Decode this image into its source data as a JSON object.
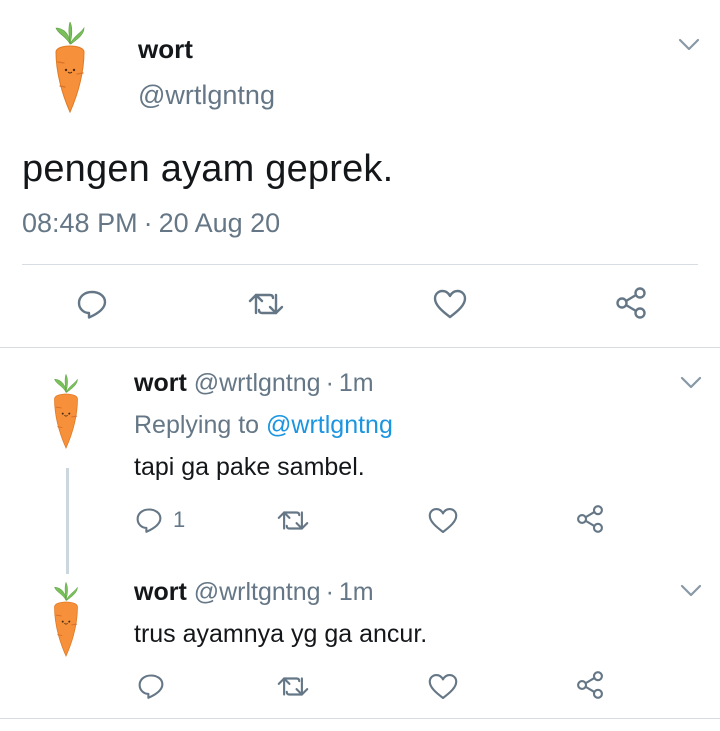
{
  "main_tweet": {
    "author_name": "wort",
    "author_handle": "@wrtlgntng",
    "text": "pengen ayam geprek.",
    "time": "08:48 PM",
    "separator": "·",
    "date": "20 Aug 20",
    "avatar_icon": "carrot-icon",
    "actions": [
      "reply-icon",
      "retweet-icon",
      "like-icon",
      "share-icon"
    ]
  },
  "replies": [
    {
      "author_name": "wort",
      "author_handle": "@wrtlgntng",
      "separator": "·",
      "age": "1m",
      "replying_prefix": "Replying to",
      "replying_to": "@wrtlgntng",
      "text": "tapi ga pake sambel.",
      "reply_count": "1"
    },
    {
      "author_name": "wort",
      "author_handle": "@wrltgntng",
      "separator": "·",
      "age": "1m",
      "text": "trus ayamnya yg ga ancur."
    }
  ],
  "colors": {
    "text": "#14171a",
    "secondary": "#657786",
    "link": "#1b95e0",
    "divider": "#d7dde2",
    "carrot": "#f7903a",
    "leaf": "#79c05a"
  }
}
